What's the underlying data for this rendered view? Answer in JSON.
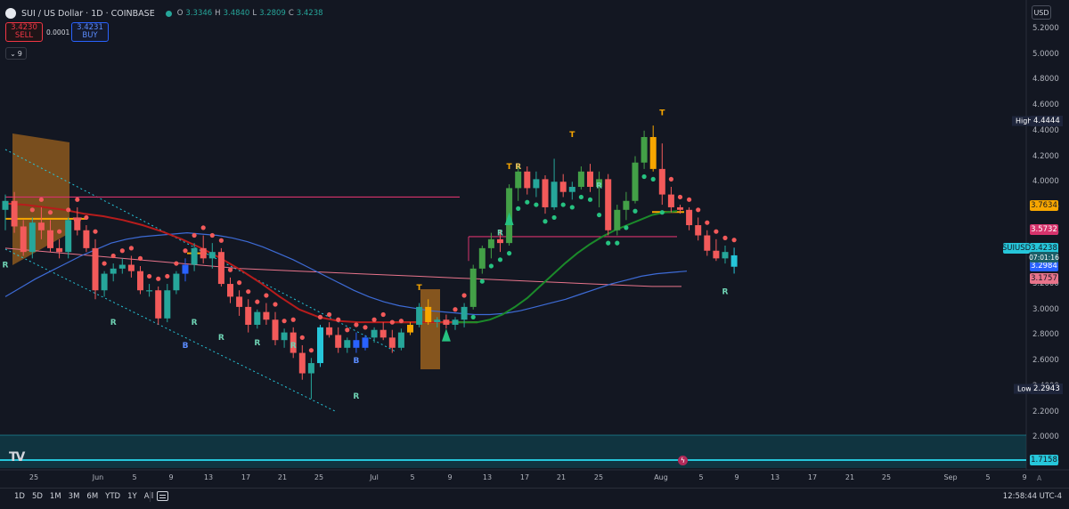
{
  "header": {
    "title": "SUI / US Dollar · 1D · COINBASE",
    "ohlc": [
      {
        "label": "O",
        "value": "3.3346"
      },
      {
        "label": "H",
        "value": "3.4840"
      },
      {
        "label": "L",
        "value": "3.2809"
      },
      {
        "label": "C",
        "value": "3.4238"
      }
    ],
    "status_color": "#26a69a",
    "currency_button": "USD"
  },
  "trade_panel": {
    "sell_price": "3.4230",
    "sell_label": "SELL",
    "spread": "0.0001",
    "buy_price": "3.4231",
    "buy_label": "BUY"
  },
  "indicator_toggle": "9",
  "price_axis": {
    "ticks": [
      "5.2000",
      "5.0000",
      "4.8000",
      "4.6000",
      "4.4000",
      "4.2000",
      "4.0000",
      "3.8000",
      "3.6000",
      "3.4000",
      "3.2000",
      "3.0000",
      "2.8000",
      "2.6000",
      "2.4000",
      "2.2000",
      "2.0000",
      "1.8000"
    ],
    "tags": [
      {
        "key": "lvl1",
        "text": "3.7634",
        "color": "#f7a600",
        "dark": true
      },
      {
        "key": "lvl2",
        "text": "3.5732",
        "color": "#d6336c"
      },
      {
        "key": "cur",
        "text": "3.4238",
        "color": "#26c6da",
        "dark": true
      },
      {
        "key": "ma1",
        "text": "3.2984",
        "color": "#2962ff"
      },
      {
        "key": "ma2",
        "text": "3.1757",
        "color": "#e8748b",
        "dark": true
      },
      {
        "key": "osc",
        "text": "1.7158",
        "color": "#26c6da",
        "dark": true
      }
    ],
    "symbol_tag": "SUIUSD",
    "countdown": "07:01:16",
    "high_label": "High",
    "high_value": "4.4444",
    "low_label": "Low",
    "low_value": "2.2943"
  },
  "date_axis": [
    "25",
    "Jun",
    "5",
    "9",
    "13",
    "17",
    "21",
    "25",
    "Jul",
    "5",
    "9",
    "13",
    "17",
    "21",
    "25",
    "Aug",
    "5",
    "9",
    "13",
    "17",
    "21",
    "25",
    "Sep",
    "5",
    "9"
  ],
  "timeframes": [
    "1D",
    "5D",
    "1M",
    "3M",
    "6M",
    "YTD",
    "1Y",
    "All"
  ],
  "clock": "12:58:44 UTC-4",
  "axis_auto": "A",
  "chart_data": {
    "type": "candlestick",
    "symbol": "SUIUSD",
    "interval": "1D",
    "ylim": [
      1.7,
      5.28
    ],
    "candles": [
      [
        3.78,
        3.9,
        3.62,
        3.85
      ],
      [
        3.85,
        3.92,
        3.6,
        3.65
      ],
      [
        3.65,
        3.7,
        3.42,
        3.45
      ],
      [
        3.45,
        3.72,
        3.4,
        3.68
      ],
      [
        3.68,
        3.8,
        3.55,
        3.62
      ],
      [
        3.62,
        3.7,
        3.45,
        3.48
      ],
      [
        3.48,
        3.55,
        3.4,
        3.45
      ],
      [
        3.45,
        3.72,
        3.4,
        3.7
      ],
      [
        3.7,
        3.8,
        3.58,
        3.62
      ],
      [
        3.62,
        3.66,
        3.45,
        3.48
      ],
      [
        3.48,
        3.55,
        3.08,
        3.15
      ],
      [
        3.15,
        3.3,
        3.1,
        3.28
      ],
      [
        3.28,
        3.36,
        3.22,
        3.32
      ],
      [
        3.32,
        3.4,
        3.28,
        3.35
      ],
      [
        3.35,
        3.42,
        3.25,
        3.3
      ],
      [
        3.3,
        3.34,
        3.12,
        3.15
      ],
      [
        3.15,
        3.2,
        3.1,
        3.15
      ],
      [
        3.15,
        3.18,
        2.88,
        2.93
      ],
      [
        2.93,
        3.2,
        2.9,
        3.15
      ],
      [
        3.15,
        3.3,
        3.12,
        3.28
      ],
      [
        3.28,
        3.4,
        3.22,
        3.35
      ],
      [
        3.35,
        3.52,
        3.3,
        3.48
      ],
      [
        3.48,
        3.58,
        3.36,
        3.4
      ],
      [
        3.4,
        3.52,
        3.32,
        3.45
      ],
      [
        3.45,
        3.48,
        3.18,
        3.2
      ],
      [
        3.2,
        3.25,
        3.05,
        3.1
      ],
      [
        3.1,
        3.15,
        2.95,
        3.02
      ],
      [
        3.02,
        3.08,
        2.82,
        2.88
      ],
      [
        2.88,
        3.0,
        2.85,
        2.98
      ],
      [
        2.98,
        3.05,
        2.88,
        2.92
      ],
      [
        2.92,
        2.98,
        2.72,
        2.76
      ],
      [
        2.76,
        2.85,
        2.7,
        2.82
      ],
      [
        2.82,
        2.86,
        2.62,
        2.66
      ],
      [
        2.66,
        2.72,
        2.45,
        2.5
      ],
      [
        2.5,
        2.62,
        2.3,
        2.58
      ],
      [
        2.58,
        2.88,
        2.55,
        2.86
      ],
      [
        2.86,
        2.9,
        2.78,
        2.8
      ],
      [
        2.8,
        2.86,
        2.66,
        2.7
      ],
      [
        2.7,
        2.78,
        2.66,
        2.76
      ],
      [
        2.76,
        2.82,
        2.66,
        2.7
      ],
      [
        2.7,
        2.8,
        2.68,
        2.78
      ],
      [
        2.78,
        2.86,
        2.74,
        2.84
      ],
      [
        2.84,
        2.9,
        2.76,
        2.78
      ],
      [
        2.78,
        2.84,
        2.66,
        2.7
      ],
      [
        2.7,
        2.85,
        2.68,
        2.82
      ],
      [
        2.82,
        2.9,
        2.8,
        2.88
      ],
      [
        2.88,
        3.05,
        2.86,
        3.02
      ],
      [
        3.02,
        3.08,
        2.88,
        2.9
      ],
      [
        2.9,
        2.94,
        2.86,
        2.92
      ],
      [
        2.92,
        2.96,
        2.85,
        2.88
      ],
      [
        2.88,
        2.94,
        2.84,
        2.92
      ],
      [
        2.92,
        3.05,
        2.86,
        3.02
      ],
      [
        3.02,
        3.35,
        3.0,
        3.32
      ],
      [
        3.32,
        3.5,
        3.28,
        3.48
      ],
      [
        3.48,
        3.6,
        3.4,
        3.55
      ],
      [
        3.55,
        3.62,
        3.45,
        3.52
      ],
      [
        3.52,
        3.98,
        3.5,
        3.95
      ],
      [
        3.95,
        4.12,
        3.85,
        4.08
      ],
      [
        4.08,
        4.12,
        3.9,
        3.95
      ],
      [
        3.95,
        4.08,
        3.88,
        4.02
      ],
      [
        4.02,
        4.05,
        3.75,
        3.8
      ],
      [
        3.8,
        4.18,
        3.78,
        4.0
      ],
      [
        4.0,
        4.06,
        3.88,
        3.92
      ],
      [
        3.92,
        4.0,
        3.86,
        3.96
      ],
      [
        3.96,
        4.12,
        3.94,
        4.08
      ],
      [
        4.08,
        4.14,
        3.92,
        3.96
      ],
      [
        3.96,
        4.08,
        3.8,
        4.02
      ],
      [
        4.02,
        4.06,
        3.58,
        3.62
      ],
      [
        3.62,
        3.82,
        3.58,
        3.78
      ],
      [
        3.78,
        3.92,
        3.7,
        3.85
      ],
      [
        3.85,
        4.2,
        3.83,
        4.15
      ],
      [
        4.15,
        4.4,
        4.1,
        4.35
      ],
      [
        4.35,
        4.44,
        4.08,
        4.1
      ],
      [
        4.1,
        4.3,
        3.82,
        3.9
      ],
      [
        3.9,
        3.96,
        3.76,
        3.8
      ],
      [
        3.8,
        3.82,
        3.75,
        3.78
      ],
      [
        3.78,
        3.8,
        3.62,
        3.66
      ],
      [
        3.66,
        3.72,
        3.54,
        3.58
      ],
      [
        3.58,
        3.62,
        3.42,
        3.46
      ],
      [
        3.46,
        3.55,
        3.38,
        3.4
      ],
      [
        3.4,
        3.5,
        3.36,
        3.45
      ],
      [
        3.3346,
        3.484,
        3.2809,
        3.4238
      ]
    ],
    "ma_blue": [
      3.1,
      3.17,
      3.24,
      3.3,
      3.36,
      3.42,
      3.47,
      3.52,
      3.55,
      3.57,
      3.58,
      3.59,
      3.6,
      3.59,
      3.58,
      3.56,
      3.53,
      3.49,
      3.44,
      3.39,
      3.33,
      3.27,
      3.21,
      3.15,
      3.1,
      3.06,
      3.03,
      3.01,
      2.99,
      2.98,
      2.97,
      2.96,
      2.96,
      2.97,
      2.99,
      3.02,
      3.05,
      3.08,
      3.12,
      3.16,
      3.2,
      3.23,
      3.26,
      3.28,
      3.29,
      3.3
    ],
    "ma_red": [
      3.83,
      3.82,
      3.8,
      3.78,
      3.75,
      3.73,
      3.7,
      3.66,
      3.61,
      3.55,
      3.48,
      3.4,
      3.31,
      3.21,
      3.1,
      3.0,
      2.94,
      2.91,
      2.9,
      2.9,
      2.9,
      2.9,
      2.9,
      2.9
    ],
    "ma_green": [
      2.9,
      2.9,
      2.9,
      2.92,
      2.96,
      3.02,
      3.09,
      3.18,
      3.27,
      3.36,
      3.44,
      3.51,
      3.57,
      3.62,
      3.66,
      3.7,
      3.74,
      3.76,
      3.77
    ],
    "ma_pink": [
      3.48,
      3.46,
      3.44,
      3.42,
      3.4,
      3.38,
      3.36,
      3.34,
      3.32,
      3.31,
      3.3,
      3.29,
      3.28,
      3.27,
      3.26,
      3.25,
      3.24,
      3.23,
      3.22,
      3.21,
      3.2,
      3.19,
      3.18,
      3.18
    ],
    "levels": {
      "resistance": 3.88,
      "orange_left": 3.71,
      "green_level": 2.9,
      "pink_level": 3.57,
      "lvl_right": 3.7634
    },
    "labels_R": [
      [
        0,
        3.33
      ],
      [
        12,
        2.88
      ],
      [
        21,
        2.88
      ],
      [
        24,
        2.76
      ],
      [
        28,
        2.72
      ],
      [
        32,
        2.7
      ],
      [
        39,
        2.3
      ],
      [
        55,
        3.58
      ],
      [
        66,
        3.95
      ],
      [
        80,
        3.12
      ]
    ],
    "labels_B": [
      [
        20,
        2.7
      ],
      [
        39,
        2.58
      ]
    ],
    "labels_T": [
      [
        46,
        3.15
      ],
      [
        56,
        4.1
      ],
      [
        63,
        4.35
      ],
      [
        73,
        4.52
      ]
    ]
  }
}
